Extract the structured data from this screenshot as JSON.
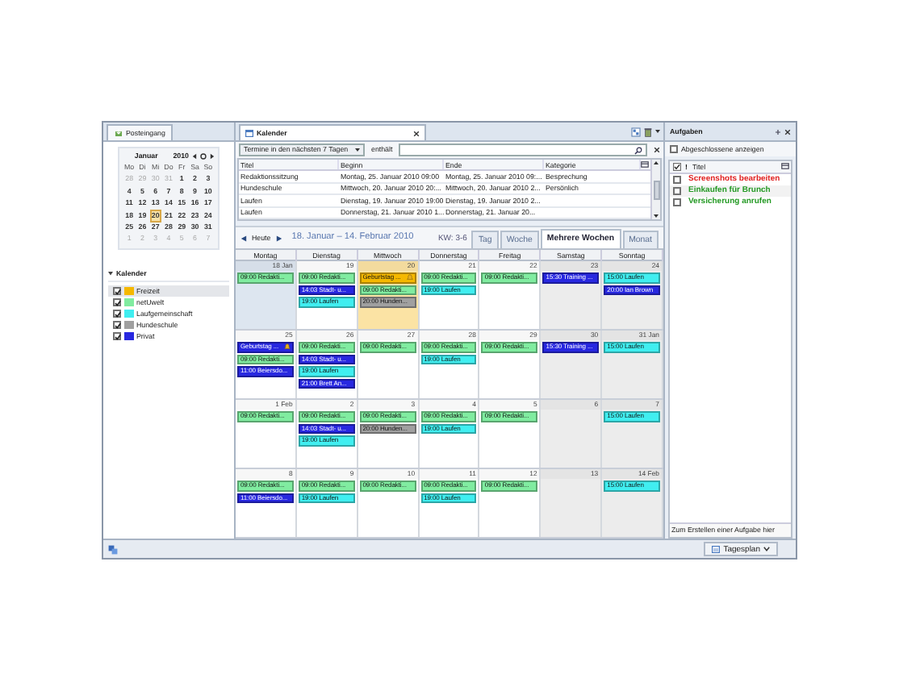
{
  "left_panel": {
    "tab": {
      "label": "Posteingang"
    },
    "mini_month": {
      "month": "Januar",
      "year": "2010",
      "weekdays": [
        "Mo",
        "Di",
        "Mi",
        "Do",
        "Fr",
        "Sa",
        "So"
      ],
      "weeks": [
        [
          {
            "day": "28",
            "other_month": true,
            "selected": false
          },
          {
            "day": "29",
            "other_month": true,
            "selected": false
          },
          {
            "day": "30",
            "other_month": true,
            "selected": false
          },
          {
            "day": "31",
            "other_month": true,
            "selected": false
          },
          {
            "day": "1",
            "other_month": false,
            "selected": false
          },
          {
            "day": "2",
            "other_month": false,
            "selected": false
          },
          {
            "day": "3",
            "other_month": false,
            "selected": false
          }
        ],
        [
          {
            "day": "4",
            "other_month": false,
            "selected": false
          },
          {
            "day": "5",
            "other_month": false,
            "selected": false
          },
          {
            "day": "6",
            "other_month": false,
            "selected": false
          },
          {
            "day": "7",
            "other_month": false,
            "selected": false
          },
          {
            "day": "8",
            "other_month": false,
            "selected": false
          },
          {
            "day": "9",
            "other_month": false,
            "selected": false
          },
          {
            "day": "10",
            "other_month": false,
            "selected": false
          }
        ],
        [
          {
            "day": "11",
            "other_month": false,
            "selected": false
          },
          {
            "day": "12",
            "other_month": false,
            "selected": false
          },
          {
            "day": "13",
            "other_month": false,
            "selected": false
          },
          {
            "day": "14",
            "other_month": false,
            "selected": false
          },
          {
            "day": "15",
            "other_month": false,
            "selected": false
          },
          {
            "day": "16",
            "other_month": false,
            "selected": false
          },
          {
            "day": "17",
            "other_month": false,
            "selected": false
          }
        ],
        [
          {
            "day": "18",
            "other_month": false,
            "selected": false
          },
          {
            "day": "19",
            "other_month": false,
            "selected": false
          },
          {
            "day": "20",
            "other_month": false,
            "selected": true
          },
          {
            "day": "21",
            "other_month": false,
            "selected": false
          },
          {
            "day": "22",
            "other_month": false,
            "selected": false
          },
          {
            "day": "23",
            "other_month": false,
            "selected": false
          },
          {
            "day": "24",
            "other_month": false,
            "selected": false
          }
        ],
        [
          {
            "day": "25",
            "other_month": false,
            "selected": false
          },
          {
            "day": "26",
            "other_month": false,
            "selected": false
          },
          {
            "day": "27",
            "other_month": false,
            "selected": false
          },
          {
            "day": "28",
            "other_month": false,
            "selected": false
          },
          {
            "day": "29",
            "other_month": false,
            "selected": false
          },
          {
            "day": "30",
            "other_month": false,
            "selected": false
          },
          {
            "day": "31",
            "other_month": false,
            "selected": false
          }
        ],
        [
          {
            "day": "1",
            "other_month": true,
            "selected": false
          },
          {
            "day": "2",
            "other_month": true,
            "selected": false
          },
          {
            "day": "3",
            "other_month": true,
            "selected": false
          },
          {
            "day": "4",
            "other_month": true,
            "selected": false
          },
          {
            "day": "5",
            "other_month": true,
            "selected": false
          },
          {
            "day": "6",
            "other_month": true,
            "selected": false
          },
          {
            "day": "7",
            "other_month": true,
            "selected": false
          }
        ]
      ]
    },
    "calendars": {
      "title": "Kalender",
      "expanded": true,
      "items": [
        {
          "name": "Freizeit",
          "color": "#f5b800",
          "checked": true,
          "selected": true
        },
        {
          "name": "netUwelt",
          "color": "#80eca0",
          "checked": true,
          "selected": false
        },
        {
          "name": "Laufgemeinschaft",
          "color": "#40eef0",
          "checked": true,
          "selected": false
        },
        {
          "name": "Hundeschule",
          "color": "#a0a0a0",
          "checked": true,
          "selected": false
        },
        {
          "name": "Privat",
          "color": "#2828e0",
          "checked": true,
          "selected": false
        }
      ]
    }
  },
  "calendar_tab": {
    "label": "Kalender"
  },
  "filter": {
    "range": "Termine in den nächsten 7 Tagen",
    "operator": "enthält"
  },
  "event_list": {
    "columns": [
      "Titel",
      "Beginn",
      "Ende",
      "Kategorie"
    ],
    "rows": [
      [
        "Redaktionssitzung",
        "Montag, 25. Januar 2010 09:00",
        "Montag, 25. Januar 2010 09:...",
        "Besprechung"
      ],
      [
        "Hundeschule",
        "Mittwoch, 20. Januar 2010 20:...",
        "Mittwoch, 20. Januar 2010 2...",
        "Persönlich"
      ],
      [
        "Laufen",
        "Dienstag, 19. Januar 2010 19:00",
        "Dienstag, 19. Januar 2010 2...",
        ""
      ],
      [
        "Laufen",
        "Donnerstag, 21. Januar 2010 1...",
        "Donnerstag, 21. Januar 20...",
        ""
      ]
    ]
  },
  "nav": {
    "today": "Heute",
    "range": "18. Januar – 14. Februar 2010",
    "week": "KW: 3-6",
    "views": [
      {
        "label": "Tag",
        "selected": false
      },
      {
        "label": "Woche",
        "selected": false
      },
      {
        "label": "Mehrere Wochen",
        "selected": true
      },
      {
        "label": "Monat",
        "selected": false
      }
    ]
  },
  "grid": {
    "weekdays": [
      "Montag",
      "Dienstag",
      "Mittwoch",
      "Donnerstag",
      "Freitag",
      "Samstag",
      "Sonntag"
    ],
    "weeks": [
      [
        {
          "label": "18 Jan",
          "kind": "selected",
          "events": [
            {
              "text": "09:00 Redakti...",
              "color": "#80eca0"
            }
          ]
        },
        {
          "label": "19",
          "kind": "weekday",
          "events": [
            {
              "text": "09:00 Redakti...",
              "color": "#80eca0"
            },
            {
              "text": "14:03 Stadt- u...",
              "color": "#2828e0"
            },
            {
              "text": "19:00 Laufen",
              "color": "#40eef0"
            }
          ]
        },
        {
          "label": "20",
          "kind": "today",
          "events": [
            {
              "text": "Geburtstag ...",
              "color": "#f5b800",
              "alarm": true
            },
            {
              "text": "09:00 Redakti...",
              "color": "#80eca0"
            },
            {
              "text": "20:00 Hunden...",
              "color": "#a0a0a0"
            }
          ]
        },
        {
          "label": "21",
          "kind": "weekday",
          "events": [
            {
              "text": "09:00 Redakti...",
              "color": "#80eca0"
            },
            {
              "text": "19:00 Laufen",
              "color": "#40eef0"
            }
          ]
        },
        {
          "label": "22",
          "kind": "weekday",
          "events": [
            {
              "text": "09:00 Redakti...",
              "color": "#80eca0"
            }
          ]
        },
        {
          "label": "23",
          "kind": "weekend",
          "events": [
            {
              "text": "15:30 Training ...",
              "color": "#2828e0"
            }
          ]
        },
        {
          "label": "24",
          "kind": "weekend",
          "events": [
            {
              "text": "15:00 Laufen",
              "color": "#40eef0"
            },
            {
              "text": "20:00 Ian Brown",
              "color": "#2828e0"
            }
          ]
        }
      ],
      [
        {
          "label": "25",
          "kind": "weekday",
          "events": [
            {
              "text": "Geburtstag ...",
              "color": "#2828e0",
              "alarm": true
            },
            {
              "text": "09:00 Redakti...",
              "color": "#80eca0"
            },
            {
              "text": "11:00 Beiersdo...",
              "color": "#2828e0"
            }
          ]
        },
        {
          "label": "26",
          "kind": "weekday",
          "events": [
            {
              "text": "09:00 Redakti...",
              "color": "#80eca0"
            },
            {
              "text": "14:03 Stadt- u...",
              "color": "#2828e0"
            },
            {
              "text": "19:00 Laufen",
              "color": "#40eef0"
            },
            {
              "text": "21:00 Brett An...",
              "color": "#2828e0"
            }
          ]
        },
        {
          "label": "27",
          "kind": "weekday",
          "events": [
            {
              "text": "09:00 Redakti...",
              "color": "#80eca0"
            }
          ]
        },
        {
          "label": "28",
          "kind": "weekday",
          "events": [
            {
              "text": "09:00 Redakti...",
              "color": "#80eca0"
            },
            {
              "text": "19:00 Laufen",
              "color": "#40eef0"
            }
          ]
        },
        {
          "label": "29",
          "kind": "weekday",
          "events": [
            {
              "text": "09:00 Redakti...",
              "color": "#80eca0"
            }
          ]
        },
        {
          "label": "30",
          "kind": "weekend",
          "events": [
            {
              "text": "15:30 Training ...",
              "color": "#2828e0"
            }
          ]
        },
        {
          "label": "31 Jan",
          "kind": "weekend",
          "events": [
            {
              "text": "15:00 Laufen",
              "color": "#40eef0"
            }
          ]
        }
      ],
      [
        {
          "label": "1 Feb",
          "kind": "weekday",
          "events": [
            {
              "text": "09:00 Redakti...",
              "color": "#80eca0"
            }
          ]
        },
        {
          "label": "2",
          "kind": "weekday",
          "events": [
            {
              "text": "09:00 Redakti...",
              "color": "#80eca0"
            },
            {
              "text": "14:03 Stadt- u...",
              "color": "#2828e0"
            },
            {
              "text": "19:00 Laufen",
              "color": "#40eef0"
            }
          ]
        },
        {
          "label": "3",
          "kind": "weekday",
          "events": [
            {
              "text": "09:00 Redakti...",
              "color": "#80eca0"
            },
            {
              "text": "20:00 Hunden...",
              "color": "#a0a0a0"
            }
          ]
        },
        {
          "label": "4",
          "kind": "weekday",
          "events": [
            {
              "text": "09:00 Redakti...",
              "color": "#80eca0"
            },
            {
              "text": "19:00 Laufen",
              "color": "#40eef0"
            }
          ]
        },
        {
          "label": "5",
          "kind": "weekday",
          "events": [
            {
              "text": "09:00 Redakti...",
              "color": "#80eca0"
            }
          ]
        },
        {
          "label": "6",
          "kind": "weekend"
        },
        {
          "label": "7",
          "kind": "weekend",
          "events": [
            {
              "text": "15:00 Laufen",
              "color": "#40eef0"
            }
          ]
        }
      ],
      [
        {
          "label": "8",
          "kind": "weekday",
          "events": [
            {
              "text": "09:00 Redakti...",
              "color": "#80eca0"
            },
            {
              "text": "11:00 Beiersdo...",
              "color": "#2828e0"
            }
          ]
        },
        {
          "label": "9",
          "kind": "weekday",
          "events": [
            {
              "text": "09:00 Redakti...",
              "color": "#80eca0"
            },
            {
              "text": "19:00 Laufen",
              "color": "#40eef0"
            }
          ]
        },
        {
          "label": "10",
          "kind": "weekday",
          "events": [
            {
              "text": "09:00 Redakti...",
              "color": "#80eca0"
            }
          ]
        },
        {
          "label": "11",
          "kind": "weekday",
          "events": [
            {
              "text": "09:00 Redakti...",
              "color": "#80eca0"
            },
            {
              "text": "19:00 Laufen",
              "color": "#40eef0"
            }
          ]
        },
        {
          "label": "12",
          "kind": "weekday",
          "events": [
            {
              "text": "09:00 Redakti...",
              "color": "#80eca0"
            }
          ]
        },
        {
          "label": "13",
          "kind": "weekend"
        },
        {
          "label": "14 Feb",
          "kind": "weekend",
          "events": [
            {
              "text": "15:00 Laufen",
              "color": "#40eef0"
            }
          ]
        }
      ]
    ]
  },
  "tasks": {
    "title": "Aufgaben",
    "show_completed": {
      "label": "Abgeschlossene anzeigen",
      "checked": false
    },
    "priority_column": "!",
    "title_column": "Titel",
    "items": [
      {
        "title": "Screenshots bearbeiten",
        "color": "#e02020",
        "checked": false
      },
      {
        "title": "Einkaufen für Brunch",
        "color": "#259a25",
        "checked": false
      },
      {
        "title": "Versicherung anrufen",
        "color": "#259a25",
        "checked": false
      }
    ],
    "new_task_hint": "Zum Erstellen einer Aufgabe hier"
  },
  "status_bar": {
    "view_button": "Tagesplan"
  }
}
